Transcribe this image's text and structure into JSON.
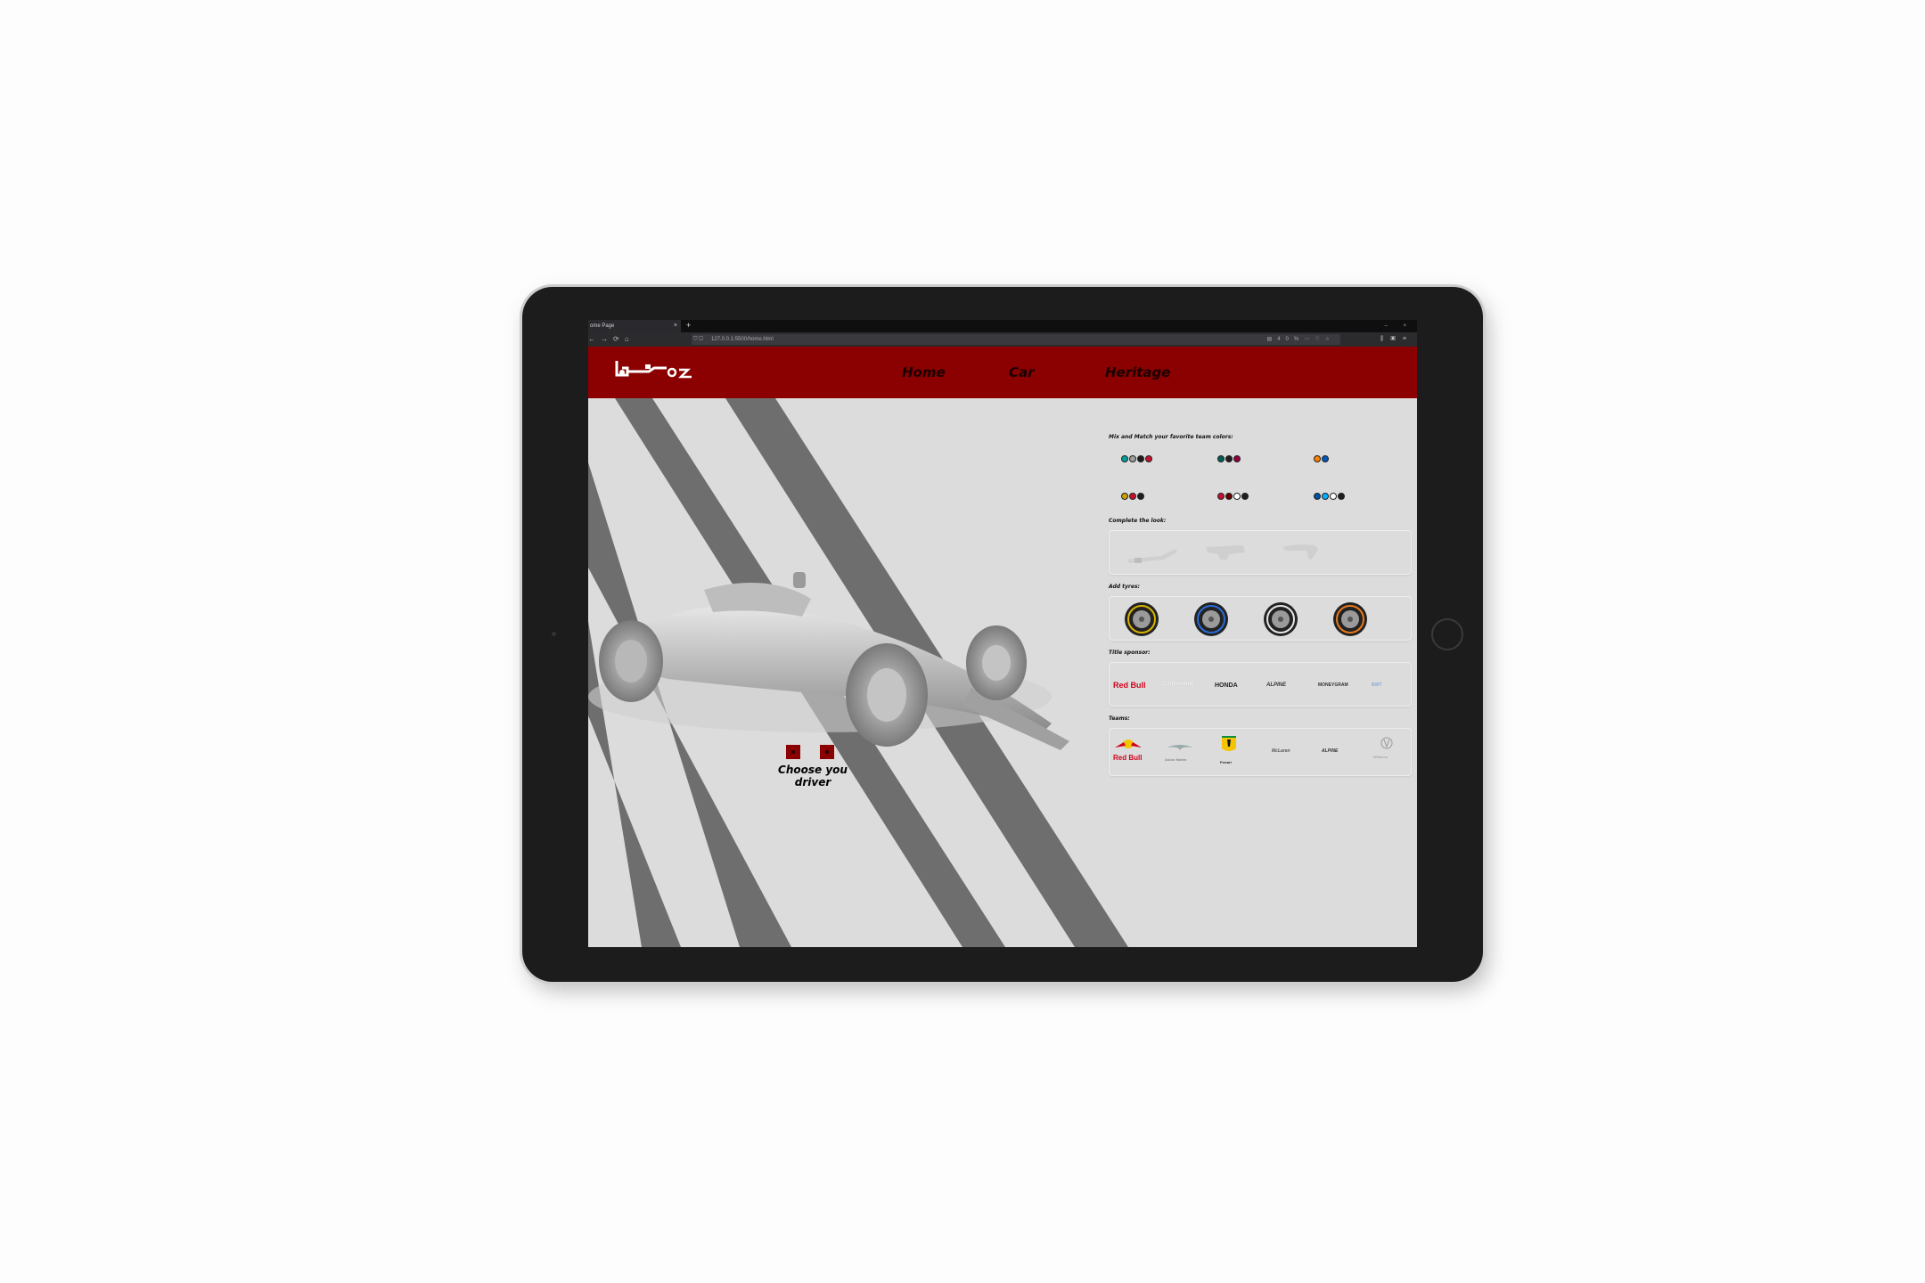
{
  "browser": {
    "tab_title": "ome Page",
    "tab_close": "×",
    "new_tab": "+",
    "url": "127.0.0.1:5500/home.html",
    "zoom": "40%",
    "nav_back": "←",
    "nav_forward": "→",
    "nav_reload": "⟳",
    "nav_home": "⌂"
  },
  "site": {
    "nav": [
      "Home",
      "Car",
      "Heritage"
    ],
    "hero": {
      "driver_label": "Choose you driver"
    },
    "sections": {
      "colors_title": "Mix and Match your favorite team colors:",
      "look_title": "Complete the look:",
      "tyres_title": "Add tyres:",
      "sponsor_title": "Title sponsor:",
      "teams_title": "Teams:"
    },
    "color_swatches": [
      [
        "#00a19c",
        "#9e9e9e",
        "#1e1e1e",
        "#c8102e"
      ],
      [
        "#005f56",
        "#1e1e1e",
        "#900040"
      ],
      [
        "#ff8000",
        "#0057b8"
      ],
      [
        "#c8a200",
        "#c8102e",
        "#1e1e1e"
      ],
      [
        "#c8102e",
        "#600000",
        "#ffffff",
        "#1e1e1e"
      ],
      [
        "#0050a0",
        "#00b0ff",
        "#ffffff",
        "#1e1e1e"
      ]
    ],
    "tyre_colors": [
      "#d8b400",
      "#2a6bd8",
      "#e8e8e8",
      "#e87a1e"
    ],
    "sponsors": [
      "Red Bull",
      "Cognizant",
      "HONDA",
      "ALPINE",
      "MONEYGRAM",
      "BWT"
    ],
    "teams": [
      "Red Bull",
      "Aston Martin",
      "Ferrari",
      "McLaren",
      "ALPINE",
      "Williams"
    ]
  }
}
